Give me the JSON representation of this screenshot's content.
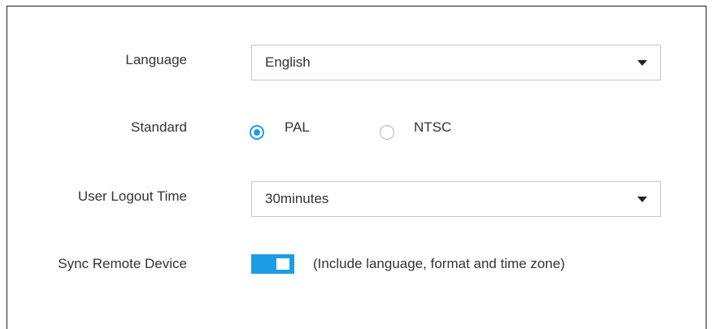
{
  "language": {
    "label": "Language",
    "value": "English",
    "caret_icon": "triangle-down-icon"
  },
  "standard": {
    "label": "Standard",
    "options": [
      {
        "label": "PAL",
        "selected": true
      },
      {
        "label": "NTSC",
        "selected": false
      }
    ]
  },
  "logout": {
    "label": "User Logout Time",
    "value": "30minutes",
    "caret_icon": "triangle-down-icon"
  },
  "sync": {
    "label": "Sync Remote Device",
    "enabled": true,
    "note": "(Include language, format and time zone)"
  },
  "colors": {
    "accent": "#1c9de6",
    "text": "#333333",
    "border": "#c8c8c8"
  }
}
